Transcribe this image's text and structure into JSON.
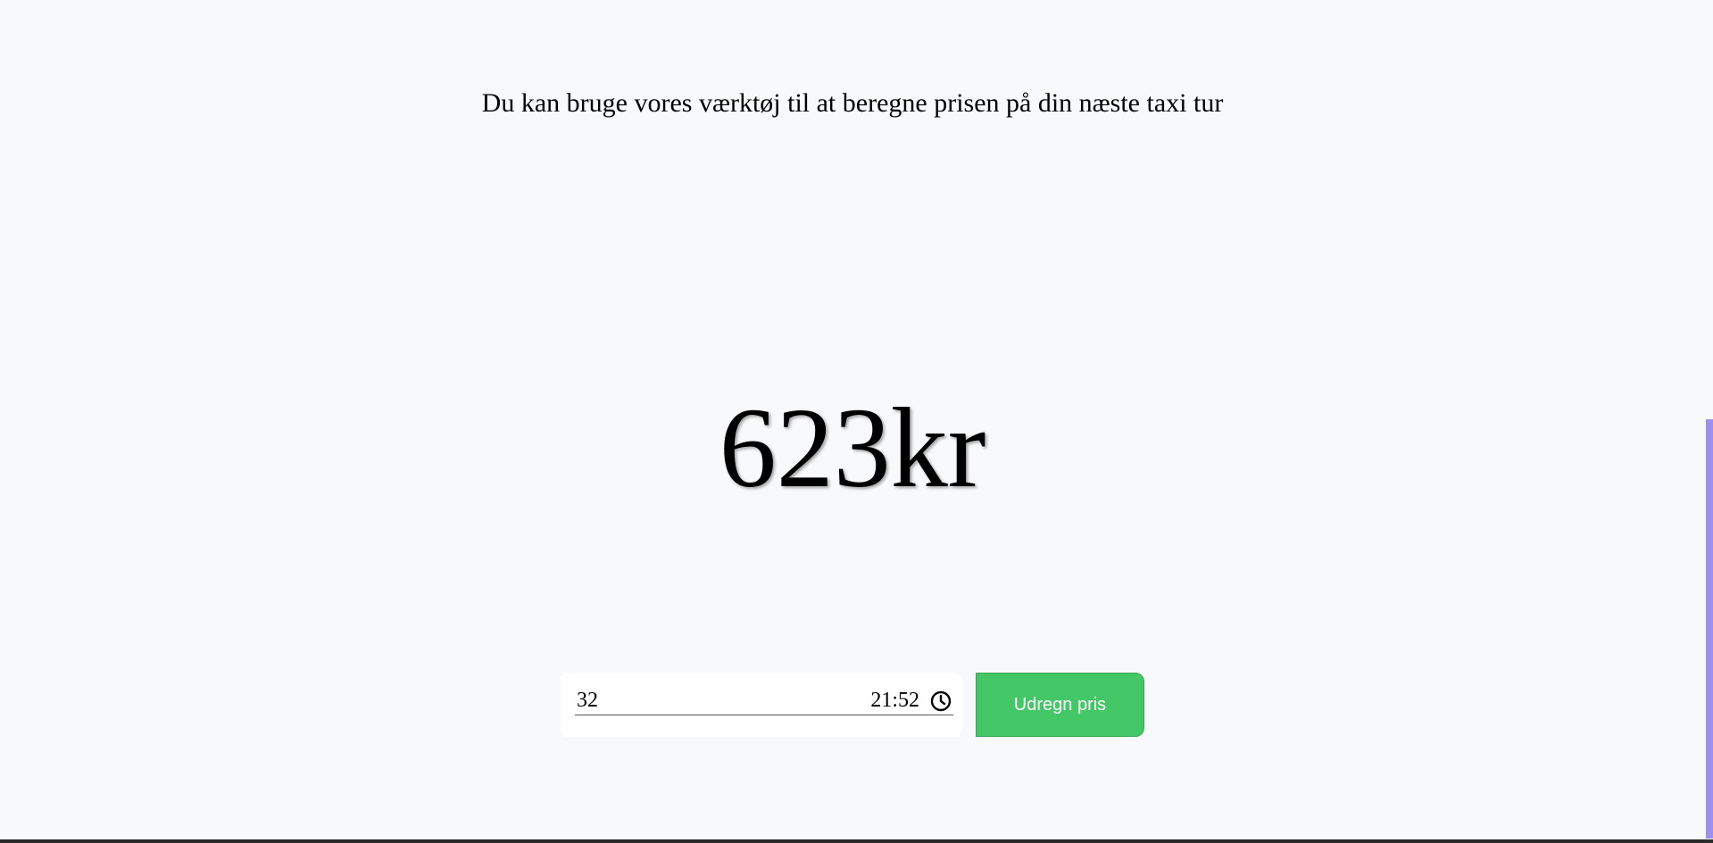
{
  "intro": {
    "text": "Du kan bruge vores værktøj til at beregne prisen på din næste taxi tur"
  },
  "result": {
    "price": "623kr"
  },
  "form": {
    "distance_value": "32",
    "time_value": "21:52",
    "time_icon": "clock-icon",
    "submit_label": "Udregn pris"
  },
  "colors": {
    "background": "#f8f9fa",
    "button": "#44c767",
    "scrollbar_thumb": "#9b8ff0"
  }
}
